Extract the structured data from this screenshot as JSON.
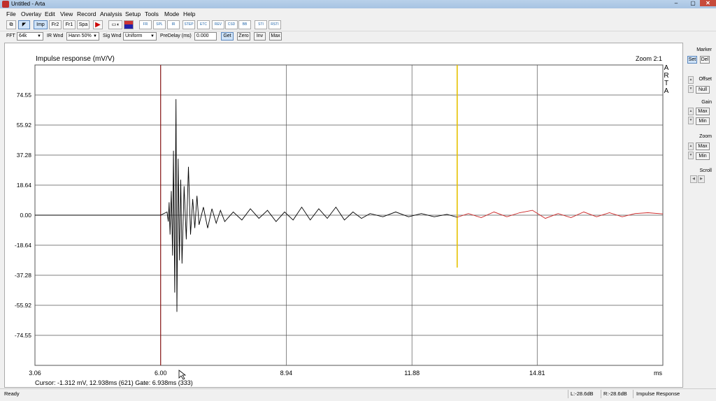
{
  "window": {
    "title": "Untitled - Arta",
    "min": "–",
    "max": "▢",
    "close": "✕"
  },
  "menu": [
    "File",
    "Overlay",
    "Edit",
    "View",
    "Record",
    "Analysis",
    "Setup",
    "Tools",
    "Mode",
    "Help"
  ],
  "toolbar": {
    "mode_buttons": [
      "Imp",
      "Fr2",
      "Fr1",
      "Spa"
    ],
    "icons": [
      "copy-icon",
      "arrow-icon",
      "play-icon",
      "generator-icon",
      "color-icon",
      "fr-icon",
      "spl-icon",
      "dist-icon",
      "step-icon",
      "etc-icon",
      "rev-icon",
      "csd-icon",
      "bb-icon",
      "sti-icon",
      "rasti-icon"
    ],
    "icon_labels": [
      "FR",
      "SPL",
      "IR",
      "STEP",
      "ETC",
      "REV",
      "CSD",
      "BB",
      "STI",
      "RSTI"
    ]
  },
  "toolbar2": {
    "fft_label": "FFT",
    "fft_value": "64k",
    "irwnd_label": "IR Wnd",
    "irwnd_value": "Hann 50%",
    "sigwnd_label": "Sig Wnd",
    "sigwnd_value": "Uniform",
    "predelay_label": "PreDelay (ms)",
    "predelay_value": "0.000",
    "get": "Get",
    "zero": "Zero",
    "inv": "Inv",
    "max": "Max"
  },
  "chart_data": {
    "type": "line",
    "title": "Impulse response (mV/V)",
    "zoom": "Zoom 2:1",
    "side_text": [
      "A",
      "R",
      "T",
      "A"
    ],
    "xlabel": "ms",
    "xlim": [
      3.06,
      17.75
    ],
    "x_ticks": [
      "3.06",
      "6.00",
      "8.94",
      "11.88",
      "14.81"
    ],
    "ylim": [
      -93.19,
      93.19
    ],
    "y_ticks": [
      "74.55",
      "55.92",
      "37.28",
      "18.64",
      "0.00",
      "-18.64",
      "-37.28",
      "-55.92",
      "-74.55"
    ],
    "grid": true,
    "markers": {
      "cursor_ms": 6.0,
      "gate_ms": 12.938
    },
    "colors": {
      "signal": "#000000",
      "post_gate": "#cc2222",
      "pre_cursor": "#cc2222",
      "cursor": "#8b1a1a",
      "gate": "#e6c200",
      "grid": "#555555"
    },
    "series": [
      {
        "x": [
          3.06,
          5.0,
          6.0,
          6.15,
          6.18,
          6.2,
          6.22,
          6.25,
          6.28,
          6.3,
          6.33,
          6.36,
          6.38,
          6.41,
          6.44,
          6.47,
          6.5,
          6.55,
          6.6,
          6.65,
          6.7,
          6.75,
          6.8,
          6.85,
          6.9,
          7.0,
          7.1,
          7.2,
          7.3,
          7.4,
          7.5,
          7.7,
          7.9,
          8.1,
          8.3,
          8.5,
          8.7,
          8.9,
          9.1,
          9.3,
          9.5,
          9.7,
          9.9,
          10.1,
          10.3,
          10.5,
          10.7,
          10.9,
          11.2,
          11.5,
          11.8,
          12.1,
          12.4,
          12.7,
          12.938
        ],
        "values": [
          0,
          0,
          0,
          2,
          -4,
          8,
          -12,
          15,
          -25,
          40,
          -48,
          72,
          -60,
          35,
          -28,
          22,
          -30,
          18,
          -15,
          30,
          -12,
          10,
          -8,
          12,
          -6,
          5,
          -8,
          4,
          -5,
          3,
          -4,
          2,
          -3,
          4,
          -2,
          3,
          -4,
          2,
          -3,
          5,
          -3,
          4,
          -2,
          5,
          -3,
          2,
          -2,
          1,
          -1,
          2,
          -1,
          1,
          -1,
          0.5,
          -1.3
        ]
      },
      {
        "x": [
          12.938,
          13.2,
          13.5,
          13.8,
          14.1,
          14.4,
          14.7,
          15.0,
          15.3,
          15.6,
          15.9,
          16.2,
          16.5,
          16.8,
          17.1,
          17.4,
          17.75
        ],
        "values": [
          -1.3,
          1,
          -1.5,
          2,
          -1,
          1.5,
          3,
          -2,
          1,
          -1.5,
          2,
          -1,
          1.5,
          -1,
          1,
          1.5,
          0.8
        ]
      }
    ],
    "cursor_readout": "Cursor: -1.312 mV, 12.938ms (621)  Gate: 6.938ms (333)"
  },
  "right_panel": {
    "marker": "Marker",
    "set": "Set",
    "del": "Del",
    "offset": "Offset",
    "null": "Null",
    "gain": "Gain",
    "gain_max": "Max",
    "gain_min": "Min",
    "zoom": "Zoom",
    "zoom_max": "Max",
    "zoom_min": "Min",
    "scroll": "Scroll"
  },
  "status": {
    "ready": "Ready",
    "l": "L:-28.6dB",
    "r": "R:-28.6dB",
    "mode": "Impulse Response"
  }
}
